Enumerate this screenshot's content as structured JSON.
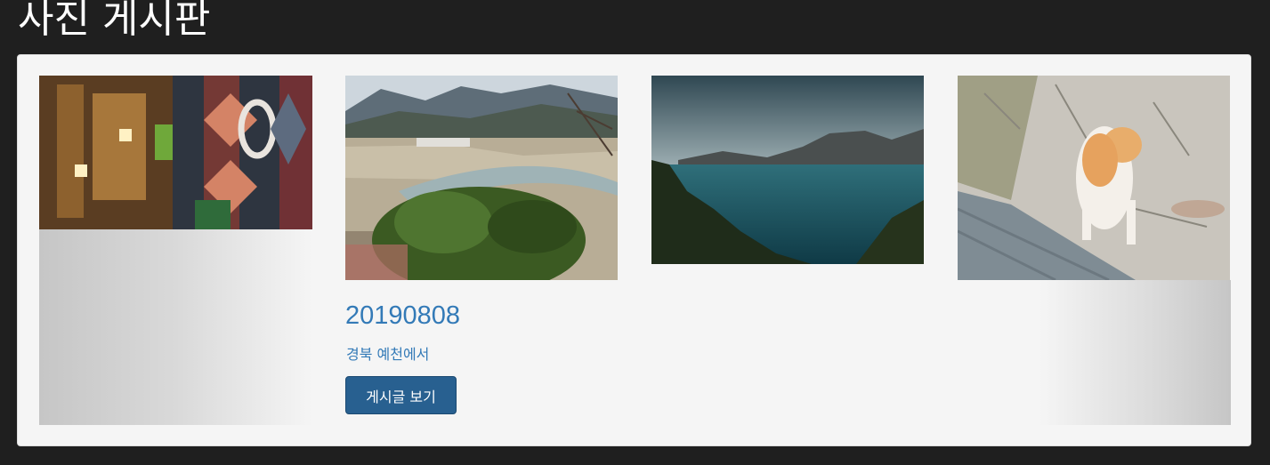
{
  "header": {
    "title": "사진 게시판"
  },
  "gallery": {
    "items": [
      {
        "image_icon": "cathedral-interior-photo"
      },
      {
        "image_icon": "valley-river-landscape-photo",
        "caption": {
          "title": "20190808",
          "description": "경북 예천에서",
          "button_label": "게시글 보기"
        }
      },
      {
        "image_icon": "lake-mountains-photo"
      },
      {
        "image_icon": "sleeping-cat-on-wall-photo"
      }
    ]
  },
  "colors": {
    "background": "#1f1f1f",
    "panel": "#f5f5f5",
    "link": "#337ab7",
    "button": "#286090"
  }
}
